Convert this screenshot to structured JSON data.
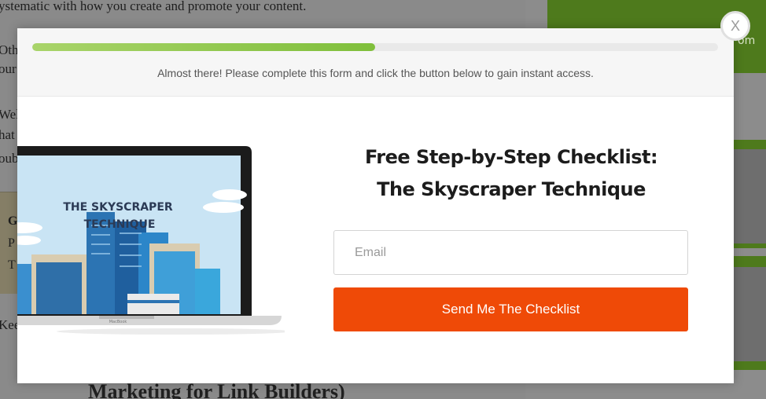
{
  "background": {
    "lines": [
      "ystematic with how you create and promote your content.",
      "Oth",
      "our",
      "Wel",
      "hat",
      "oub",
      "Kee"
    ],
    "callout_lines": [
      "G",
      "P",
      "T"
    ],
    "heading": "Marketing for Link Builders)",
    "sidebar_text": "om"
  },
  "modal": {
    "progress_percent": 50,
    "progress_text": "Almost there! Please complete this form and click the button below to gain instant access.",
    "image": {
      "screen_title_line1": "THE SKYSCRAPER",
      "screen_title_line2": "TECHNIQUE",
      "brand": "MacBook"
    },
    "headline_line1": "Free Step-by-Step Checklist:",
    "headline_line2": "The Skyscraper Technique",
    "email_placeholder": "Email",
    "email_value": "",
    "submit_label": "Send Me The Checklist",
    "close_label": "X"
  },
  "colors": {
    "accent": "#ef4a07",
    "progress": "#7fbf3b"
  }
}
